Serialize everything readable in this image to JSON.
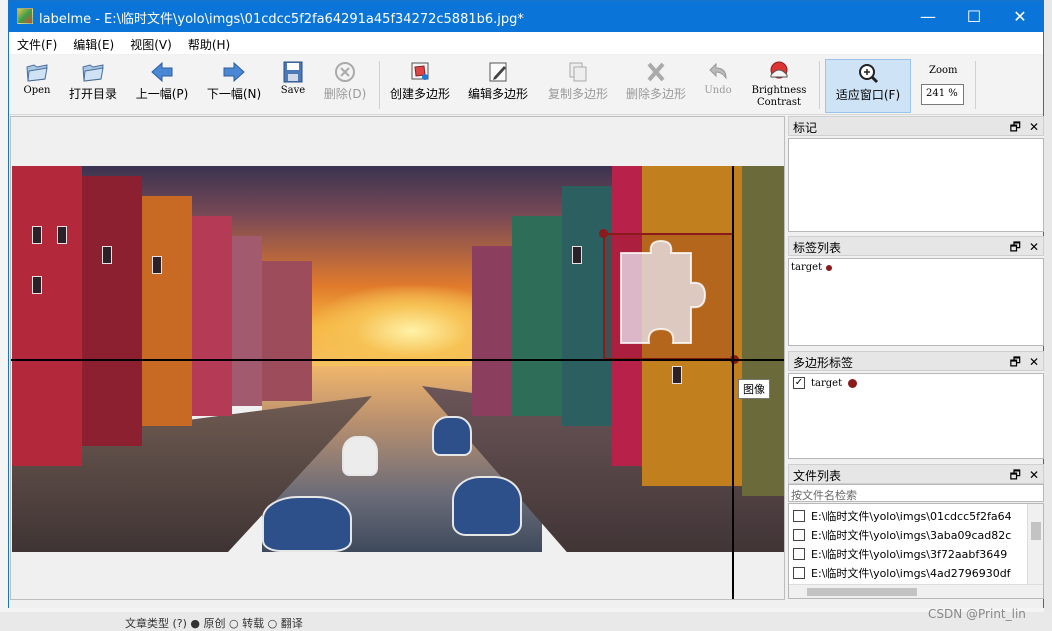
{
  "window": {
    "title": "labelme - E:\\临时文件\\yolo\\imgs\\01cdcc5f2fa64291a45f34272c5881b6.jpg*",
    "controls": {
      "minimize": "—",
      "maximize": "☐",
      "close": "✕"
    }
  },
  "menu": [
    "文件(F)",
    "编辑(E)",
    "视图(V)",
    "帮助(H)"
  ],
  "toolbar": {
    "open": "Open",
    "open_dir": "打开目录",
    "prev": "上一幅(P)",
    "next": "下一幅(N)",
    "save": "Save",
    "delete": "删除(D)",
    "create_poly": "创建多边形",
    "edit_poly": "编辑多边形",
    "copy_poly": "复制多边形",
    "delete_poly": "删除多边形",
    "undo": "Undo",
    "brightness": "Brightness",
    "contrast": "Contrast",
    "fit_window": "适应窗口(F)",
    "zoom_label": "Zoom",
    "zoom_value": "241 %"
  },
  "canvas": {
    "tooltip": "图像"
  },
  "docks": {
    "flags": {
      "title": "标记"
    },
    "label_list": {
      "title": "标签列表",
      "items": [
        {
          "label": "target",
          "color": "#8b1a1a"
        }
      ]
    },
    "poly_labels": {
      "title": "多边形标签",
      "items": [
        {
          "label": "target",
          "checked": true,
          "color": "#8b1a1a"
        }
      ]
    },
    "file_list": {
      "title": "文件列表",
      "search_placeholder": "按文件名检索",
      "files": [
        "E:\\临时文件\\yolo\\imgs\\01cdcc5f2fa64",
        "E:\\临时文件\\yolo\\imgs\\3aba09cad82c",
        "E:\\临时文件\\yolo\\imgs\\3f72aabf3649",
        "E:\\临时文件\\yolo\\imgs\\4ad2796930df"
      ]
    },
    "float_icon": "🗗",
    "close_icon": "✕"
  },
  "background_strip": "文章类型 (?)   ● 原创   ○ 转载   ○ 翻译",
  "watermark": "CSDN @Print_lin"
}
